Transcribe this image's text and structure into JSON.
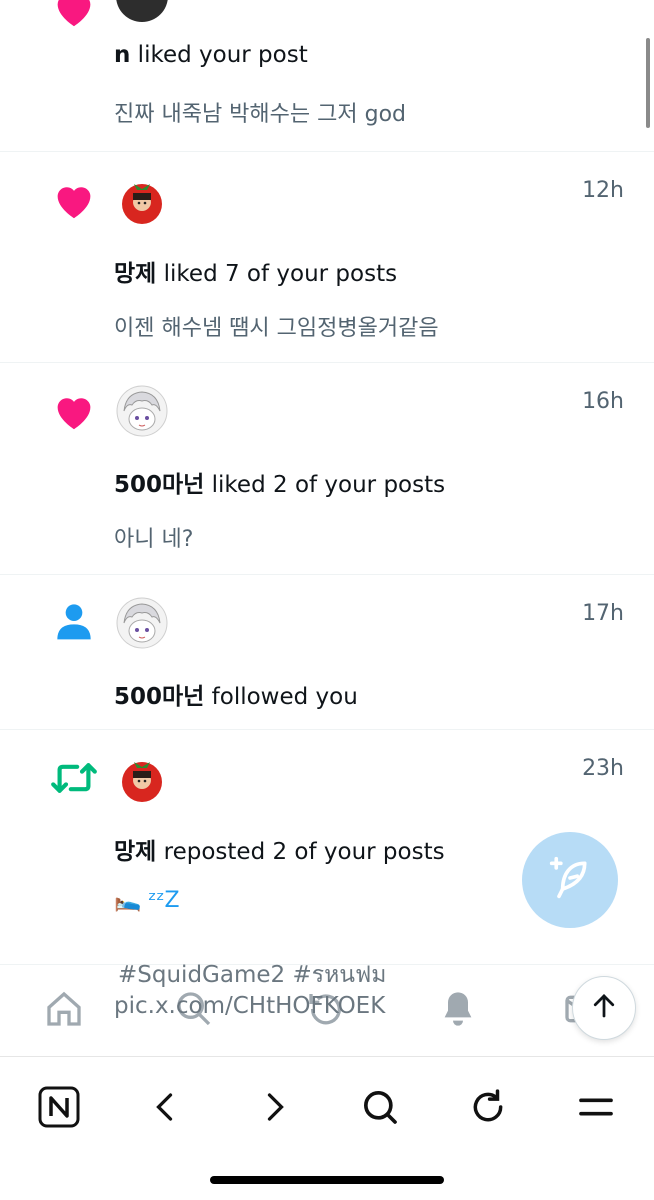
{
  "colors": {
    "like": "#f91880",
    "follow": "#1d9bf0",
    "repost": "#00ba7c",
    "fab": "#b7dcf6"
  },
  "notifications": [
    {
      "type": "like",
      "icon": "heart-icon",
      "time": "",
      "actor": "n",
      "action": " liked your post",
      "preview": "진짜 내죽남 박해수는 그저 god"
    },
    {
      "type": "like",
      "icon": "heart-icon",
      "time": "12h",
      "actor": "망제",
      "action": " liked 7 of your posts",
      "preview": "이젠 해수넴 땜시 그임정병올거같음"
    },
    {
      "type": "like",
      "icon": "heart-icon",
      "time": "16h",
      "actor": "500마넌",
      "action": " liked 2 of your posts",
      "preview": "아니 네?"
    },
    {
      "type": "follow",
      "icon": "person-icon",
      "time": "17h",
      "actor": "500마넌",
      "action": " followed you",
      "preview": ""
    },
    {
      "type": "repost",
      "icon": "repost-icon",
      "time": "23h",
      "actor": "망제",
      "action": " reposted 2 of your posts",
      "preview": "🛌 ᶻᶻZ",
      "hashtags": "#SquidGame2 #รหนฟม",
      "link": "pic.x.com/CHtHOFKOEK"
    }
  ],
  "tabbar": {
    "items": [
      "home-icon",
      "search-icon",
      "grok-icon",
      "bell-icon",
      "messages-icon"
    ]
  },
  "browser_toolbar": {
    "items": [
      "naver-n-icon",
      "back-chevron-icon",
      "forward-chevron-icon",
      "search-icon",
      "reload-icon",
      "menu-icon"
    ],
    "naver_label": "N"
  }
}
